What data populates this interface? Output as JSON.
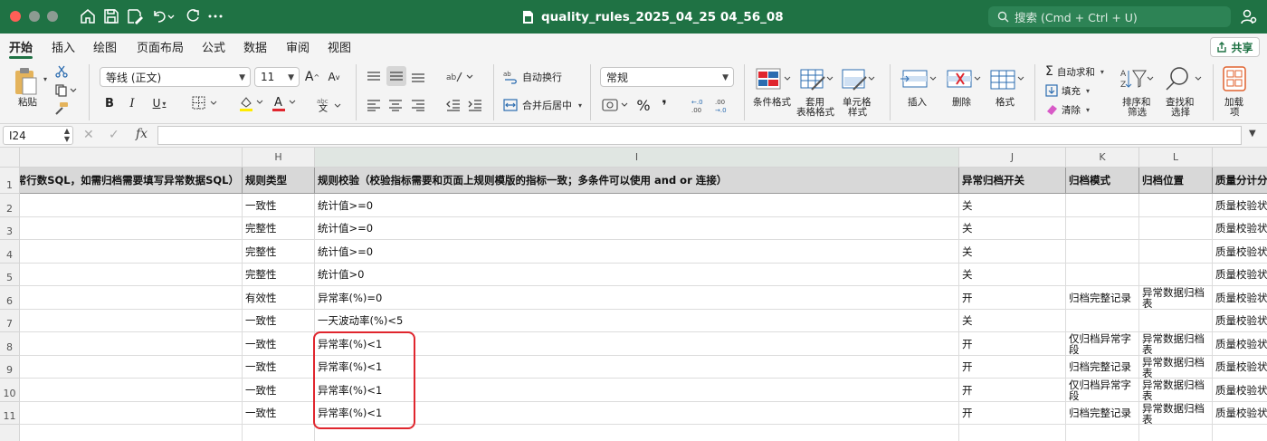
{
  "titlebar": {
    "doc_title": "quality_rules_2025_04_25 04_56_08",
    "search_placeholder": "搜索 (Cmd + Ctrl + U)"
  },
  "menu": {
    "tabs": [
      "开始",
      "插入",
      "绘图",
      "页面布局",
      "公式",
      "数据",
      "审阅",
      "视图"
    ],
    "active_tab": "开始",
    "share_label": "共享"
  },
  "ribbon": {
    "paste_label": "粘贴",
    "font_name": "等线 (正文)",
    "font_size": "11",
    "wrap_text_label": "自动换行",
    "merge_center_label": "合并后居中",
    "number_format": "常规",
    "percent_symbol": "%",
    "conditional_format_label": "条件格式",
    "table_format_label_1": "套用",
    "table_format_label_2": "表格格式",
    "cell_style_label_1": "单元格",
    "cell_style_label_2": "样式",
    "insert_label": "插入",
    "delete_label": "删除",
    "format_label": "格式",
    "autosum_label": "自动求和",
    "fill_label": "填充",
    "clear_label": "清除",
    "sort_filter_label_1": "排序和",
    "sort_filter_label_2": "筛选",
    "find_select_label_1": "查找和",
    "find_select_label_2": "选择",
    "addins_label_1": "加载",
    "addins_label_2": "项"
  },
  "formula_bar": {
    "cell_ref": "I24",
    "fx": "fx",
    "value": ""
  },
  "grid": {
    "columns": [
      "H",
      "I",
      "J",
      "K",
      "L"
    ],
    "row_numbers": [
      "1",
      "2",
      "3",
      "4",
      "5",
      "6",
      "7",
      "8",
      "9",
      "10",
      "11"
    ],
    "header": {
      "G": "异常行数SQL，如需归档需要填写异常数据SQL）",
      "H": "规则类型",
      "I": "规则校验（校验指标需要和页面上规则模版的指标一致；多条件可以使用 and or 连接）",
      "J": "异常归档开关",
      "K": "归档模式",
      "L": "归档位置",
      "M": "质量分计分"
    },
    "rows": [
      {
        "H": "一致性",
        "I": "统计值>=0",
        "J": "关",
        "K": "",
        "L": "",
        "M": "质量校验状"
      },
      {
        "H": "完整性",
        "I": "统计值>=0",
        "J": "关",
        "K": "",
        "L": "",
        "M": "质量校验状"
      },
      {
        "H": "完整性",
        "I": "统计值>=0",
        "J": "关",
        "K": "",
        "L": "",
        "M": "质量校验状"
      },
      {
        "H": "完整性",
        "I": "统计值>0",
        "J": "关",
        "K": "",
        "L": "",
        "M": "质量校验状"
      },
      {
        "H": "有效性",
        "I": "异常率(%)=0",
        "J": "开",
        "K": "归档完整记录",
        "L": "异常数据归档表",
        "M": "质量校验状"
      },
      {
        "H": "一致性",
        "I": "一天波动率(%)<5",
        "J": "关",
        "K": "",
        "L": "",
        "M": "质量校验状"
      },
      {
        "H": "一致性",
        "I": "异常率(%)<1",
        "J": "开",
        "K": "仅归档异常字段",
        "L": "异常数据归档表",
        "M": "质量校验状"
      },
      {
        "H": "一致性",
        "I": "异常率(%)<1",
        "J": "开",
        "K": "归档完整记录",
        "L": "异常数据归档表",
        "M": "质量校验状"
      },
      {
        "H": "一致性",
        "I": "异常率(%)<1",
        "J": "开",
        "K": "仅归档异常字段",
        "L": "异常数据归档表",
        "M": "质量校验状"
      },
      {
        "H": "一致性",
        "I": "异常率(%)<1",
        "J": "开",
        "K": "归档完整记录",
        "L": "异常数据归档表",
        "M": "质量校验状"
      }
    ]
  }
}
